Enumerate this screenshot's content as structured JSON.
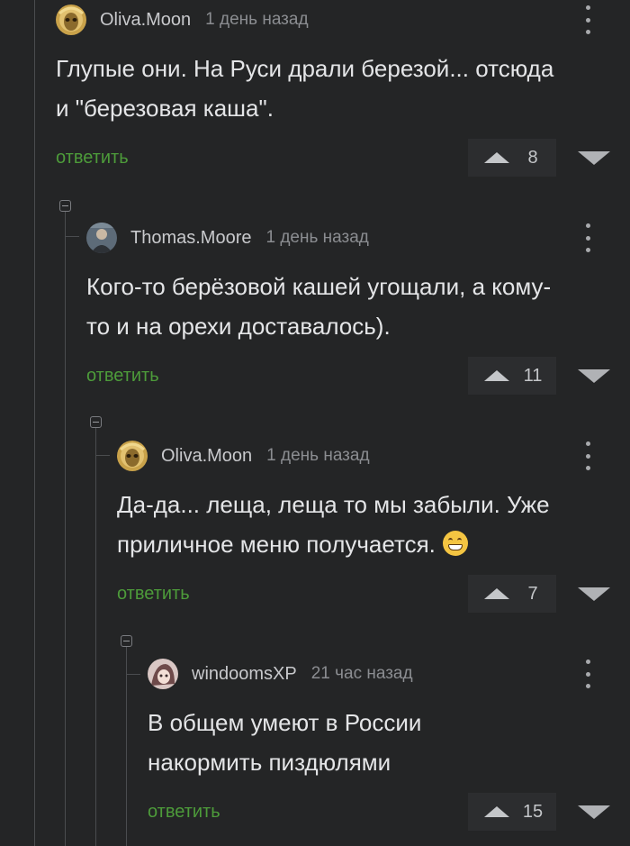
{
  "comments": [
    {
      "author": "Oliva.Moon",
      "time": "1 день назад",
      "text_lines": [
        "Глупые они. На Руси драли березой... отсюда",
        "и \"березовая каша\"."
      ],
      "reply_label": "ответить",
      "score": "8",
      "avatar_icon": "mask-avatar-icon"
    },
    {
      "author": "Thomas.Moore",
      "time": "1 день назад",
      "text_lines": [
        "Кого-то берёзовой кашей угощали, а кому-",
        "то и на орехи доставалось)."
      ],
      "reply_label": "ответить",
      "score": "11",
      "avatar_icon": "person-avatar-icon"
    },
    {
      "author": "Oliva.Moon",
      "time": "1 день назад",
      "text_lines": [
        "Да-да... леща, леща то мы забыли. Уже",
        "приличное меню получается."
      ],
      "emoji": "grinning-face-icon",
      "reply_label": "ответить",
      "score": "7",
      "avatar_icon": "mask-avatar-icon"
    },
    {
      "author": "windoomsXP",
      "time": "21 час назад",
      "text_lines": [
        "В общем умеют в России",
        "накормить пиздюлями"
      ],
      "reply_label": "ответить",
      "score": "15",
      "avatar_icon": "anime-avatar-icon"
    }
  ],
  "colors": {
    "background": "#242526",
    "reply_link": "#4d9b3a",
    "text": "#e4e5e7",
    "muted": "#8b8d91"
  }
}
